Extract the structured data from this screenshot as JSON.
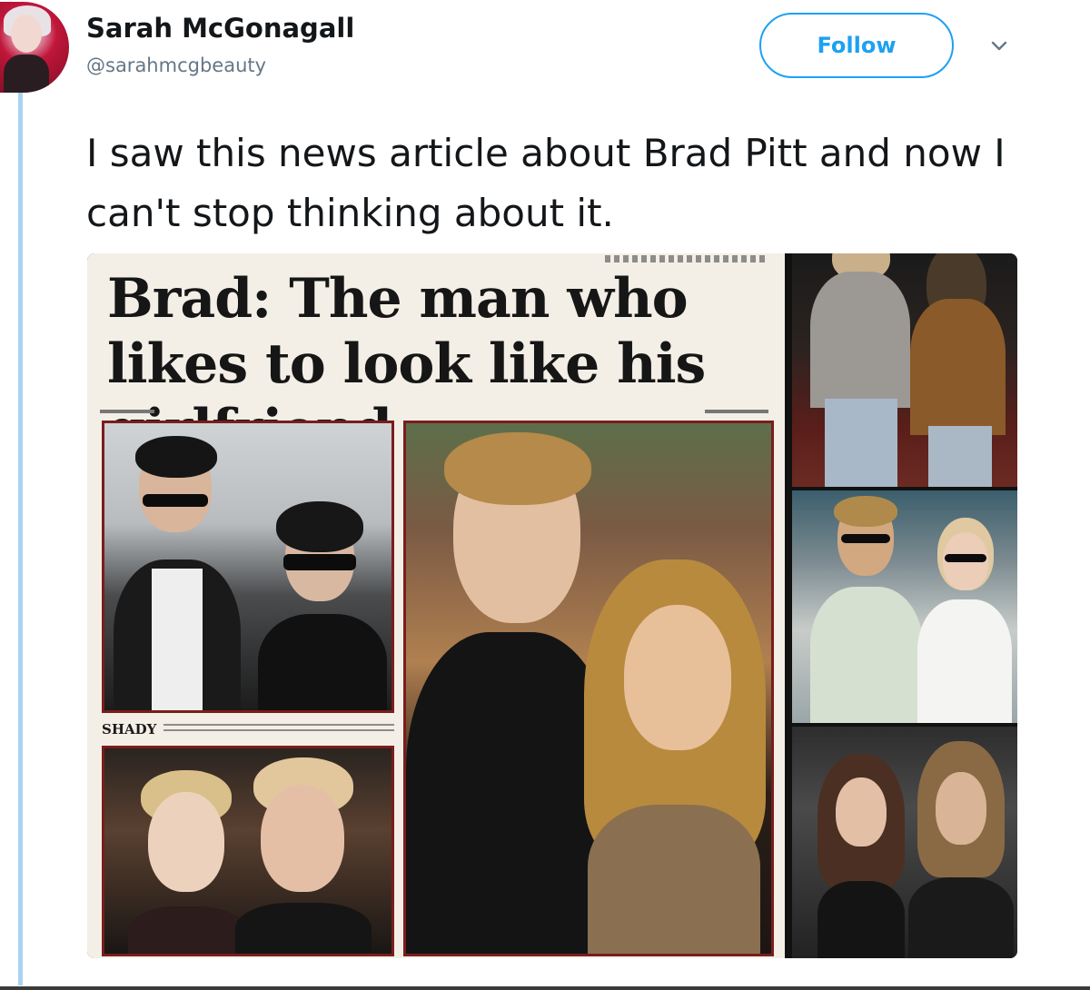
{
  "user": {
    "display_name": "Sarah McGonagall",
    "handle": "@sarahmcgbeauty"
  },
  "follow_button_label": "Follow",
  "tweet": {
    "text": "I saw this news article about Brad Pitt and now I can't stop thinking about it."
  },
  "newspaper": {
    "headline": "Brad: The man who likes to look like his girlfriend",
    "caption_label": "SHADY"
  },
  "colors": {
    "accent": "#1da1f2",
    "thread_line": "#a9d3f2",
    "secondary_text": "#657786",
    "photo_frame": "#7a1d1d"
  },
  "icons": {
    "more_options": "chevron-down-icon"
  }
}
